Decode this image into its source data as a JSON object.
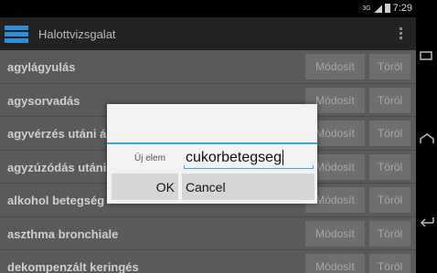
{
  "status": {
    "time": "7:29",
    "network": "3G"
  },
  "actionbar": {
    "title": "Halottvizsgalat"
  },
  "list": {
    "rows": [
      {
        "label": "agylágyulás",
        "modify": "Módosít",
        "delete": "Töröl"
      },
      {
        "label": "agysorvadás",
        "modify": "Módosít",
        "delete": "Töröl"
      },
      {
        "label": "agyvérzés utáni á",
        "modify": "Módosít",
        "delete": "Töröl"
      },
      {
        "label": "agyzúzódás utáni",
        "modify": "Módosít",
        "delete": "Töröl"
      },
      {
        "label": "alkohol betegség",
        "modify": "Módosít",
        "delete": "Töröl"
      },
      {
        "label": "aszthma bronchiale",
        "modify": "Módosít",
        "delete": "Töröl"
      },
      {
        "label": "dekompenzált keringés",
        "modify": "Módosít",
        "delete": "Töröl"
      }
    ]
  },
  "dialog": {
    "field_label": "Új elem",
    "field_value": "cukorbetegseg",
    "ok_label": "OK",
    "cancel_label": "Cancel"
  },
  "colors": {
    "accent": "#3aa7d9",
    "app_icon": "#2f8fd6"
  }
}
